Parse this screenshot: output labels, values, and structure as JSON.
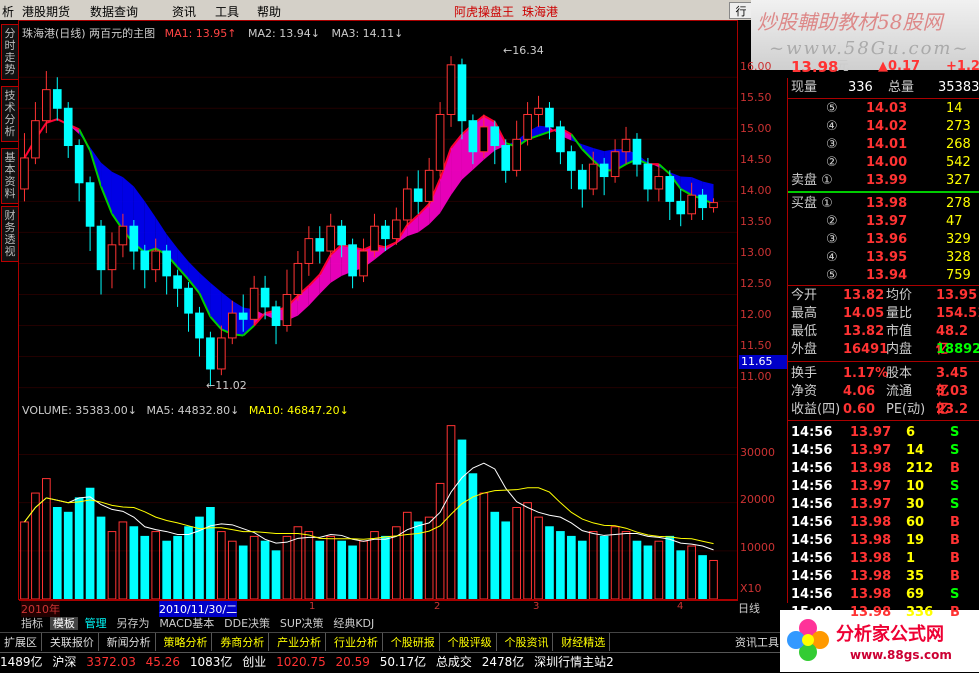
{
  "menu": {
    "items": [
      "析",
      "港股期货",
      "数据查询",
      "资讯",
      "工具",
      "帮助"
    ],
    "title": "阿虎操盘王",
    "stock": "珠海港",
    "right_btn": "行"
  },
  "brand": {
    "line1": "炒股輔助教材58股网",
    "line2": "~www.58Gu.com~"
  },
  "left_tabs": [
    "分时走势",
    "技术分析",
    "基本资料",
    "财务透视"
  ],
  "chart": {
    "header_name": "珠海港(日线)",
    "header_formula": "两百元的主图",
    "ma1": "MA1: 13.95↑",
    "ma2": "MA2: 13.94↓",
    "ma3": "MA3: 14.11↓",
    "high_label": "16.34",
    "low_label": "11.02",
    "cursor_price": "11.65"
  },
  "price_axis": [
    "16.00",
    "15.50",
    "15.00",
    "14.50",
    "14.00",
    "13.50",
    "13.00",
    "12.50",
    "12.00",
    "11.50",
    "11.00"
  ],
  "vol_hdr": {
    "volume": "VOLUME: 35383.00↓",
    "ma5": "MA5: 44832.80↓",
    "ma10": "MA10: 46847.20↓"
  },
  "vol_axis": [
    "30000",
    "20000",
    "10000"
  ],
  "vol_unit": "X10",
  "date_bar": {
    "year": "2010年",
    "cursor": "2010/11/30/二",
    "marks": [
      "1",
      "2",
      "3",
      "4"
    ],
    "period": "日线"
  },
  "bottom_tabs": [
    "指标",
    "模板",
    "管理",
    "另存为",
    "MACD基本",
    "DDE决策",
    "SUP决策",
    "经典KDJ"
  ],
  "func_tabs": [
    "扩展区",
    "关联报价",
    "新闻分析",
    "策略分析",
    "券商分析",
    "产业分析",
    "行业分析",
    "个股研报",
    "个股评级",
    "个股资讯",
    "财经精选"
  ],
  "status_bar": [
    "1489亿",
    "沪深",
    "3372.03",
    "45.26",
    "1083亿",
    "创业",
    "1020.75",
    "20.59",
    "50.17亿",
    "总成交",
    "2478亿",
    "深圳行情主站2"
  ],
  "status_right": "资讯工具",
  "logo2": {
    "text": "分析家公式网",
    "url": "www.88gs.com"
  },
  "quote": {
    "price": "13.98",
    "unit": "元",
    "change": "▲0.17",
    "pct": "+1.2",
    "vol_label": "现量",
    "vol": "336",
    "total_label": "总量",
    "total": "35383",
    "asks": [
      {
        "n": "⑤",
        "p": "14.03",
        "v": "14"
      },
      {
        "n": "④",
        "p": "14.02",
        "v": "273"
      },
      {
        "n": "③",
        "p": "14.01",
        "v": "268"
      },
      {
        "n": "②",
        "p": "14.00",
        "v": "542"
      },
      {
        "n": "卖盘 ①",
        "p": "13.99",
        "v": "327"
      }
    ],
    "bids": [
      {
        "n": "买盘 ①",
        "p": "13.98",
        "v": "278"
      },
      {
        "n": "②",
        "p": "13.97",
        "v": "47"
      },
      {
        "n": "③",
        "p": "13.96",
        "v": "329"
      },
      {
        "n": "④",
        "p": "13.95",
        "v": "328"
      },
      {
        "n": "⑤",
        "p": "13.94",
        "v": "759"
      }
    ],
    "stats": [
      [
        "今开",
        "13.82",
        "均价",
        "13.95"
      ],
      [
        "最高",
        "14.05",
        "量比",
        "154.51"
      ],
      [
        "最低",
        "13.82",
        "市值",
        "48.2亿"
      ],
      [
        "外盘",
        "16491",
        "内盘",
        "18892"
      ],
      [
        "换手",
        "1.17%",
        "股本",
        "3.45亿"
      ],
      [
        "净资",
        "4.06",
        "流通",
        "3.03亿"
      ],
      [
        "收益(四)",
        "0.60",
        "PE(动)",
        "23.2"
      ]
    ],
    "ticks": [
      [
        "14:56",
        "13.97",
        "6",
        "S"
      ],
      [
        "14:56",
        "13.97",
        "14",
        "S"
      ],
      [
        "14:56",
        "13.98",
        "212",
        "B"
      ],
      [
        "14:56",
        "13.97",
        "10",
        "S"
      ],
      [
        "14:56",
        "13.97",
        "30",
        "S"
      ],
      [
        "14:56",
        "13.98",
        "60",
        "B"
      ],
      [
        "14:56",
        "13.98",
        "19",
        "B"
      ],
      [
        "14:56",
        "13.98",
        "1",
        "B"
      ],
      [
        "14:56",
        "13.98",
        "35",
        "B"
      ],
      [
        "14:56",
        "13.98",
        "69",
        "S"
      ],
      [
        "15:00",
        "13.98",
        "336",
        "B"
      ]
    ]
  },
  "candles": [
    [
      14.2,
      14.7,
      14.0,
      15.1
    ],
    [
      14.7,
      15.3,
      14.6,
      15.6
    ],
    [
      15.3,
      15.8,
      15.1,
      16.1
    ],
    [
      15.8,
      15.5,
      15.3,
      16.0
    ],
    [
      15.5,
      14.9,
      14.7,
      15.6
    ],
    [
      14.9,
      14.3,
      14.0,
      15.0
    ],
    [
      14.3,
      13.6,
      13.2,
      14.4
    ],
    [
      13.6,
      12.9,
      12.5,
      13.7
    ],
    [
      12.9,
      13.3,
      12.6,
      13.5
    ],
    [
      13.3,
      13.6,
      13.1,
      13.8
    ],
    [
      13.6,
      13.2,
      12.9,
      13.7
    ],
    [
      13.2,
      12.9,
      12.6,
      13.3
    ],
    [
      12.9,
      13.2,
      12.7,
      13.4
    ],
    [
      13.2,
      12.8,
      12.5,
      13.3
    ],
    [
      12.8,
      12.6,
      12.3,
      12.9
    ],
    [
      12.6,
      12.2,
      11.9,
      12.7
    ],
    [
      12.2,
      11.8,
      11.5,
      12.3
    ],
    [
      11.8,
      11.3,
      11.02,
      11.9
    ],
    [
      11.3,
      11.8,
      11.2,
      12.0
    ],
    [
      11.8,
      12.2,
      11.7,
      12.4
    ],
    [
      12.2,
      12.1,
      11.9,
      12.5
    ],
    [
      12.1,
      12.6,
      12.0,
      12.8
    ],
    [
      12.6,
      12.3,
      12.1,
      12.8
    ],
    [
      12.3,
      12.0,
      11.7,
      12.4
    ],
    [
      12.0,
      12.5,
      11.9,
      12.9
    ],
    [
      12.5,
      13.0,
      12.4,
      13.2
    ],
    [
      13.0,
      13.4,
      12.8,
      13.6
    ],
    [
      13.4,
      13.2,
      13.0,
      13.6
    ],
    [
      13.2,
      13.6,
      13.1,
      13.8
    ],
    [
      13.6,
      13.3,
      13.1,
      13.7
    ],
    [
      13.3,
      12.8,
      12.6,
      13.4
    ],
    [
      12.8,
      13.2,
      12.7,
      13.4
    ],
    [
      13.2,
      13.6,
      13.1,
      13.8
    ],
    [
      13.6,
      13.4,
      13.2,
      13.7
    ],
    [
      13.4,
      13.7,
      13.3,
      13.9
    ],
    [
      13.7,
      14.2,
      13.6,
      14.4
    ],
    [
      14.2,
      14.0,
      13.8,
      14.5
    ],
    [
      14.0,
      14.5,
      13.9,
      14.7
    ],
    [
      14.5,
      15.4,
      14.4,
      15.6
    ],
    [
      15.4,
      16.2,
      15.2,
      16.34
    ],
    [
      16.2,
      15.3,
      15.0,
      16.3
    ],
    [
      15.3,
      14.8,
      14.6,
      15.4
    ],
    [
      14.8,
      15.2,
      14.7,
      15.4
    ],
    [
      15.2,
      14.9,
      14.6,
      15.3
    ],
    [
      14.9,
      14.5,
      14.3,
      15.0
    ],
    [
      14.5,
      15.0,
      14.4,
      15.3
    ],
    [
      15.0,
      15.4,
      14.9,
      15.6
    ],
    [
      15.4,
      15.5,
      15.2,
      15.7
    ],
    [
      15.5,
      15.2,
      15.0,
      15.6
    ],
    [
      15.2,
      14.8,
      14.6,
      15.3
    ],
    [
      14.8,
      14.5,
      14.2,
      14.9
    ],
    [
      14.5,
      14.2,
      13.9,
      14.6
    ],
    [
      14.2,
      14.6,
      14.1,
      14.8
    ],
    [
      14.6,
      14.4,
      14.1,
      14.7
    ],
    [
      14.4,
      14.8,
      14.3,
      15.0
    ],
    [
      14.8,
      15.0,
      14.6,
      15.2
    ],
    [
      15.0,
      14.6,
      14.4,
      15.1
    ],
    [
      14.6,
      14.2,
      14.0,
      14.7
    ],
    [
      14.2,
      14.4,
      14.0,
      14.6
    ],
    [
      14.4,
      14.0,
      13.7,
      14.5
    ],
    [
      14.0,
      13.8,
      13.6,
      14.2
    ],
    [
      13.8,
      14.1,
      13.7,
      14.3
    ],
    [
      14.1,
      13.9,
      13.7,
      14.2
    ],
    [
      13.9,
      13.98,
      13.82,
      14.05
    ]
  ],
  "volumes": [
    16,
    22,
    25,
    19,
    18,
    21,
    23,
    17,
    14,
    16,
    15,
    13,
    14,
    12,
    13,
    15,
    17,
    19,
    14,
    12,
    11,
    13,
    12,
    10,
    13,
    15,
    14,
    12,
    13,
    12,
    11,
    12,
    14,
    13,
    15,
    18,
    16,
    17,
    24,
    36,
    33,
    26,
    22,
    18,
    16,
    19,
    20,
    17,
    15,
    14,
    13,
    12,
    14,
    13,
    15,
    14,
    12,
    11,
    12,
    13,
    10,
    11,
    9,
    8
  ]
}
